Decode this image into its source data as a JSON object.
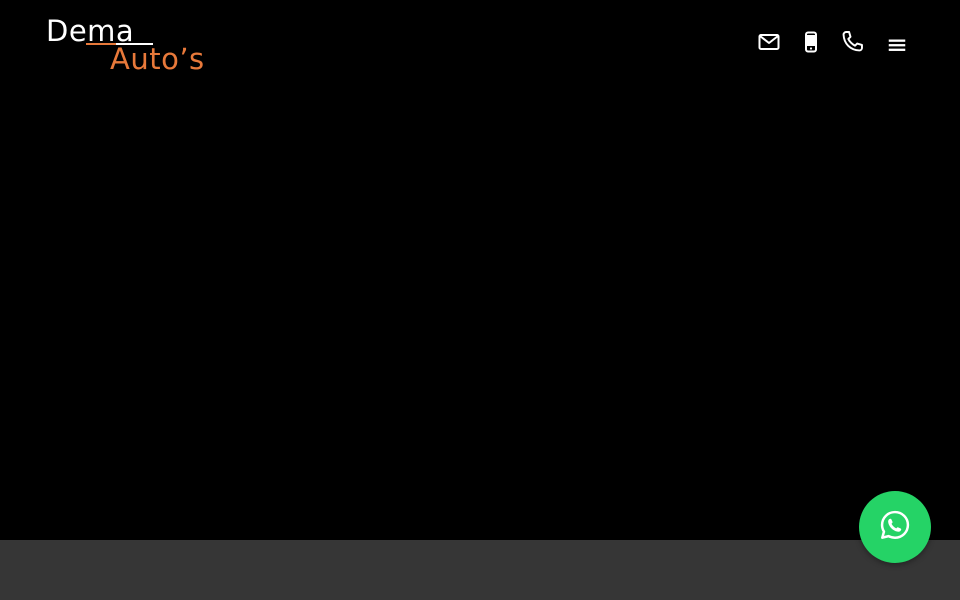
{
  "brand": {
    "name_line1": "Dema",
    "name_line2": "Auto’s",
    "accent_color": "#e8793a",
    "text_color": "#ffffff"
  },
  "header": {
    "icons": [
      {
        "name": "mail-icon",
        "label": "email"
      },
      {
        "name": "mobile-icon",
        "label": "mobile"
      },
      {
        "name": "phone-icon",
        "label": "phone"
      },
      {
        "name": "menu-icon",
        "label": "menu"
      }
    ]
  },
  "hero": {
    "background_color": "#000000"
  },
  "footer": {
    "background_color": "#363636"
  },
  "whatsapp": {
    "icon": "whatsapp-icon",
    "color": "#25d366"
  }
}
